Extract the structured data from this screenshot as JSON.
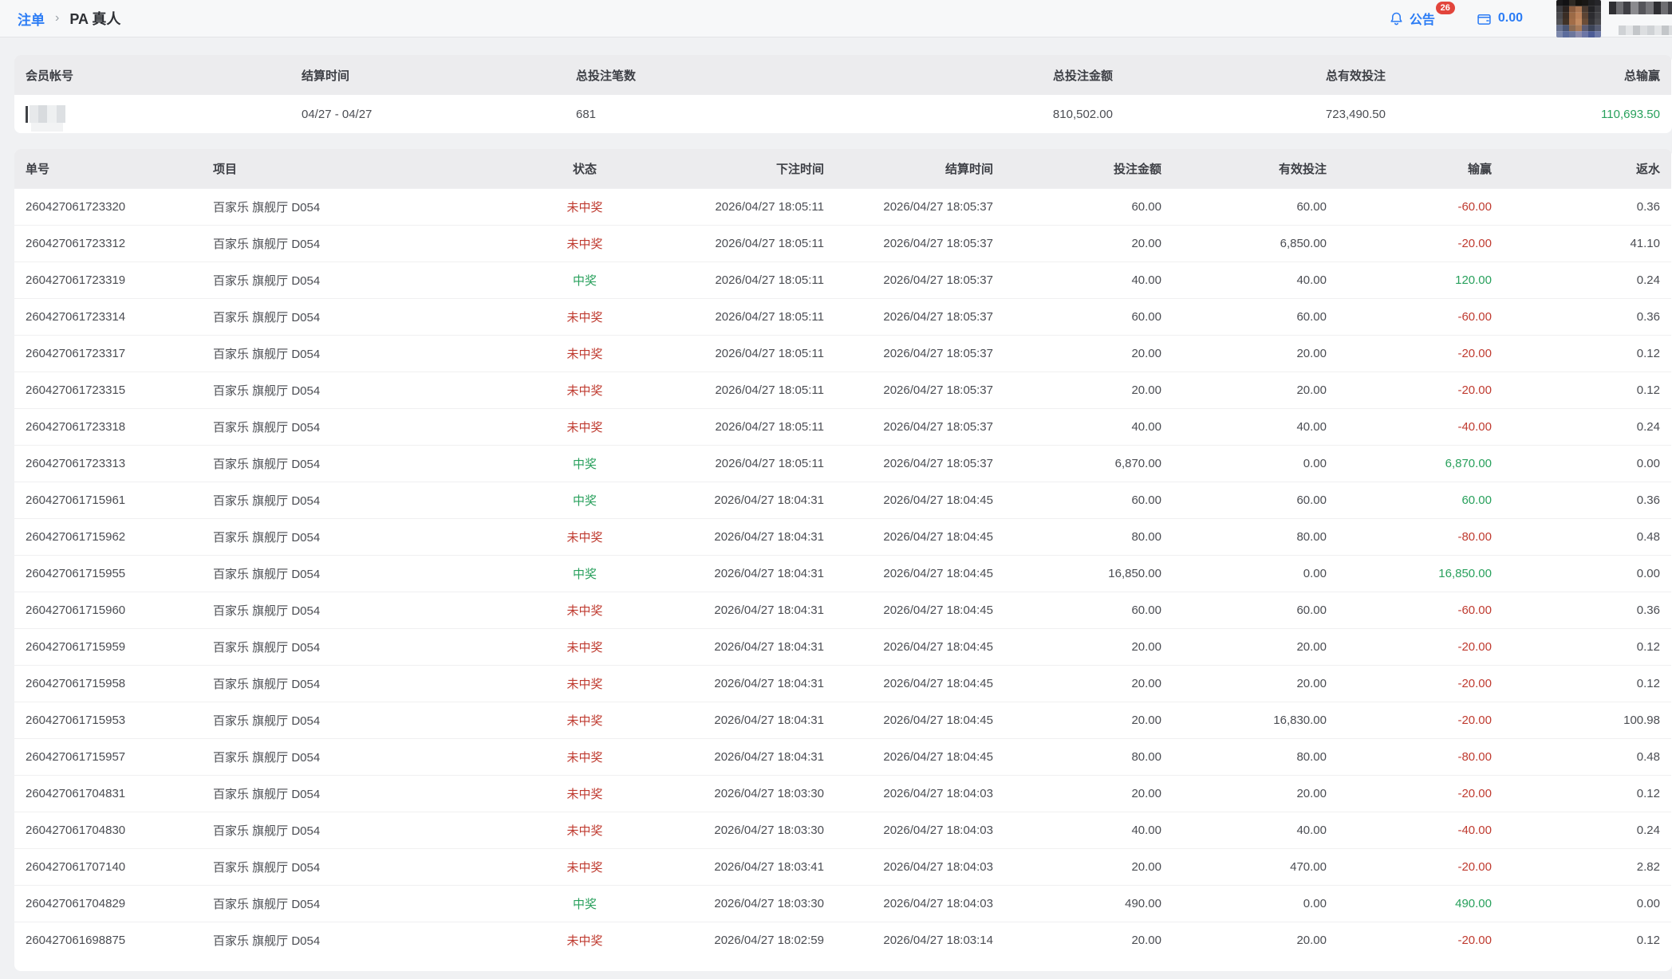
{
  "colors": {
    "accent_blue": "#2b7cf5",
    "win_green": "#28a05c",
    "lose_red": "#bf3a2f",
    "badge_red": "#e2453c"
  },
  "breadcrumb": {
    "root": "注单",
    "separator": "›",
    "current": "PA 真人"
  },
  "topbar": {
    "announcement_label": "公告",
    "announcement_count": "26",
    "balance": "0.00",
    "avatar_pixels": [
      [
        "#1a1a1c",
        "#121214",
        "#2e2a24",
        "#15130f",
        "#191715",
        "#202022",
        "#26262a"
      ],
      [
        "#3c3c40",
        "#2b2320",
        "#8a5c3e",
        "#aa7652",
        "#4a3a30",
        "#232326",
        "#3a3a3e"
      ],
      [
        "#48484c",
        "#3a2d25",
        "#9c6a46",
        "#bb8159",
        "#5c4434",
        "#2c2c30",
        "#424246"
      ],
      [
        "#525256",
        "#413226",
        "#a26d48",
        "#c28a60",
        "#6b4d38",
        "#323236",
        "#4a4a4e"
      ],
      [
        "#66708e",
        "#4a5572",
        "#8a6a52",
        "#a87a58",
        "#5c5c72",
        "#3c4458",
        "#565c72"
      ],
      [
        "#7c88ac",
        "#5c6c9c",
        "#6c769c",
        "#8c8cac",
        "#6c76a6",
        "#4c5c96",
        "#6e7aa8"
      ]
    ]
  },
  "summary": {
    "headers": [
      "会员帐号",
      "结算时间",
      "总投注笔数",
      "总投注金额",
      "总有效投注",
      "总输赢"
    ],
    "row": {
      "settle_period": "04/27 - 04/27",
      "total_bets": "681",
      "total_bet_amount": "810,502.00",
      "total_valid_bet": "723,490.50",
      "total_win_loss": "110,693.50"
    }
  },
  "table": {
    "headers": [
      "单号",
      "项目",
      "状态",
      "下注时间",
      "结算时间",
      "投注金额",
      "有效投注",
      "输赢",
      "返水"
    ],
    "rows": [
      {
        "order_no": "260427061723320",
        "item": "百家乐 旗舰厅 D054",
        "status": "未中奖",
        "result": "lose",
        "bet_time": "2026/04/27 18:05:11",
        "settle_time": "2026/04/27 18:05:37",
        "bet_amount": "60.00",
        "valid_bet": "60.00",
        "win_loss": "-60.00",
        "rebate": "0.36"
      },
      {
        "order_no": "260427061723312",
        "item": "百家乐 旗舰厅 D054",
        "status": "未中奖",
        "result": "lose",
        "bet_time": "2026/04/27 18:05:11",
        "settle_time": "2026/04/27 18:05:37",
        "bet_amount": "20.00",
        "valid_bet": "6,850.00",
        "win_loss": "-20.00",
        "rebate": "41.10"
      },
      {
        "order_no": "260427061723319",
        "item": "百家乐 旗舰厅 D054",
        "status": "中奖",
        "result": "win",
        "bet_time": "2026/04/27 18:05:11",
        "settle_time": "2026/04/27 18:05:37",
        "bet_amount": "40.00",
        "valid_bet": "40.00",
        "win_loss": "120.00",
        "rebate": "0.24"
      },
      {
        "order_no": "260427061723314",
        "item": "百家乐 旗舰厅 D054",
        "status": "未中奖",
        "result": "lose",
        "bet_time": "2026/04/27 18:05:11",
        "settle_time": "2026/04/27 18:05:37",
        "bet_amount": "60.00",
        "valid_bet": "60.00",
        "win_loss": "-60.00",
        "rebate": "0.36"
      },
      {
        "order_no": "260427061723317",
        "item": "百家乐 旗舰厅 D054",
        "status": "未中奖",
        "result": "lose",
        "bet_time": "2026/04/27 18:05:11",
        "settle_time": "2026/04/27 18:05:37",
        "bet_amount": "20.00",
        "valid_bet": "20.00",
        "win_loss": "-20.00",
        "rebate": "0.12"
      },
      {
        "order_no": "260427061723315",
        "item": "百家乐 旗舰厅 D054",
        "status": "未中奖",
        "result": "lose",
        "bet_time": "2026/04/27 18:05:11",
        "settle_time": "2026/04/27 18:05:37",
        "bet_amount": "20.00",
        "valid_bet": "20.00",
        "win_loss": "-20.00",
        "rebate": "0.12"
      },
      {
        "order_no": "260427061723318",
        "item": "百家乐 旗舰厅 D054",
        "status": "未中奖",
        "result": "lose",
        "bet_time": "2026/04/27 18:05:11",
        "settle_time": "2026/04/27 18:05:37",
        "bet_amount": "40.00",
        "valid_bet": "40.00",
        "win_loss": "-40.00",
        "rebate": "0.24"
      },
      {
        "order_no": "260427061723313",
        "item": "百家乐 旗舰厅 D054",
        "status": "中奖",
        "result": "win",
        "bet_time": "2026/04/27 18:05:11",
        "settle_time": "2026/04/27 18:05:37",
        "bet_amount": "6,870.00",
        "valid_bet": "0.00",
        "win_loss": "6,870.00",
        "rebate": "0.00"
      },
      {
        "order_no": "260427061715961",
        "item": "百家乐 旗舰厅 D054",
        "status": "中奖",
        "result": "win",
        "bet_time": "2026/04/27 18:04:31",
        "settle_time": "2026/04/27 18:04:45",
        "bet_amount": "60.00",
        "valid_bet": "60.00",
        "win_loss": "60.00",
        "rebate": "0.36"
      },
      {
        "order_no": "260427061715962",
        "item": "百家乐 旗舰厅 D054",
        "status": "未中奖",
        "result": "lose",
        "bet_time": "2026/04/27 18:04:31",
        "settle_time": "2026/04/27 18:04:45",
        "bet_amount": "80.00",
        "valid_bet": "80.00",
        "win_loss": "-80.00",
        "rebate": "0.48"
      },
      {
        "order_no": "260427061715955",
        "item": "百家乐 旗舰厅 D054",
        "status": "中奖",
        "result": "win",
        "bet_time": "2026/04/27 18:04:31",
        "settle_time": "2026/04/27 18:04:45",
        "bet_amount": "16,850.00",
        "valid_bet": "0.00",
        "win_loss": "16,850.00",
        "rebate": "0.00"
      },
      {
        "order_no": "260427061715960",
        "item": "百家乐 旗舰厅 D054",
        "status": "未中奖",
        "result": "lose",
        "bet_time": "2026/04/27 18:04:31",
        "settle_time": "2026/04/27 18:04:45",
        "bet_amount": "60.00",
        "valid_bet": "60.00",
        "win_loss": "-60.00",
        "rebate": "0.36"
      },
      {
        "order_no": "260427061715959",
        "item": "百家乐 旗舰厅 D054",
        "status": "未中奖",
        "result": "lose",
        "bet_time": "2026/04/27 18:04:31",
        "settle_time": "2026/04/27 18:04:45",
        "bet_amount": "20.00",
        "valid_bet": "20.00",
        "win_loss": "-20.00",
        "rebate": "0.12"
      },
      {
        "order_no": "260427061715958",
        "item": "百家乐 旗舰厅 D054",
        "status": "未中奖",
        "result": "lose",
        "bet_time": "2026/04/27 18:04:31",
        "settle_time": "2026/04/27 18:04:45",
        "bet_amount": "20.00",
        "valid_bet": "20.00",
        "win_loss": "-20.00",
        "rebate": "0.12"
      },
      {
        "order_no": "260427061715953",
        "item": "百家乐 旗舰厅 D054",
        "status": "未中奖",
        "result": "lose",
        "bet_time": "2026/04/27 18:04:31",
        "settle_time": "2026/04/27 18:04:45",
        "bet_amount": "20.00",
        "valid_bet": "16,830.00",
        "win_loss": "-20.00",
        "rebate": "100.98"
      },
      {
        "order_no": "260427061715957",
        "item": "百家乐 旗舰厅 D054",
        "status": "未中奖",
        "result": "lose",
        "bet_time": "2026/04/27 18:04:31",
        "settle_time": "2026/04/27 18:04:45",
        "bet_amount": "80.00",
        "valid_bet": "80.00",
        "win_loss": "-80.00",
        "rebate": "0.48"
      },
      {
        "order_no": "260427061704831",
        "item": "百家乐 旗舰厅 D054",
        "status": "未中奖",
        "result": "lose",
        "bet_time": "2026/04/27 18:03:30",
        "settle_time": "2026/04/27 18:04:03",
        "bet_amount": "20.00",
        "valid_bet": "20.00",
        "win_loss": "-20.00",
        "rebate": "0.12"
      },
      {
        "order_no": "260427061704830",
        "item": "百家乐 旗舰厅 D054",
        "status": "未中奖",
        "result": "lose",
        "bet_time": "2026/04/27 18:03:30",
        "settle_time": "2026/04/27 18:04:03",
        "bet_amount": "40.00",
        "valid_bet": "40.00",
        "win_loss": "-40.00",
        "rebate": "0.24"
      },
      {
        "order_no": "260427061707140",
        "item": "百家乐 旗舰厅 D054",
        "status": "未中奖",
        "result": "lose",
        "bet_time": "2026/04/27 18:03:41",
        "settle_time": "2026/04/27 18:04:03",
        "bet_amount": "20.00",
        "valid_bet": "470.00",
        "win_loss": "-20.00",
        "rebate": "2.82"
      },
      {
        "order_no": "260427061704829",
        "item": "百家乐 旗舰厅 D054",
        "status": "中奖",
        "result": "win",
        "bet_time": "2026/04/27 18:03:30",
        "settle_time": "2026/04/27 18:04:03",
        "bet_amount": "490.00",
        "valid_bet": "0.00",
        "win_loss": "490.00",
        "rebate": "0.00"
      },
      {
        "order_no": "260427061698875",
        "item": "百家乐 旗舰厅 D054",
        "status": "未中奖",
        "result": "lose",
        "bet_time": "2026/04/27 18:02:59",
        "settle_time": "2026/04/27 18:03:14",
        "bet_amount": "20.00",
        "valid_bet": "20.00",
        "win_loss": "-20.00",
        "rebate": "0.12"
      }
    ]
  }
}
